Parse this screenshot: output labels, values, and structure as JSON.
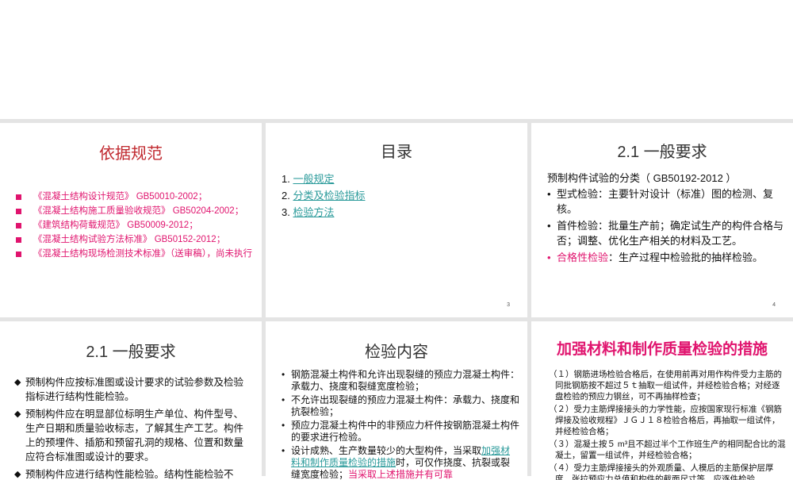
{
  "slides": [
    {
      "title": "依据规范",
      "items": [
        "《混凝土结构设计规范》 GB50010-2002；",
        "《混凝土结构施工质量验收规范》 GB50204-2002；",
        "《建筑结构荷载规范》 GB50009-2012；",
        "《混凝土结构试验方法标准》 GB50152-2012；",
        "《混凝土结构现场检测技术标准》（送审稿），尚未执行"
      ]
    },
    {
      "title": "目录",
      "items": [
        {
          "num": "1.",
          "label": "一般规定"
        },
        {
          "num": "2.",
          "label": "分类及检验指标"
        },
        {
          "num": "3.",
          "label": "检验方法"
        }
      ],
      "page": "3"
    },
    {
      "title": "2.1 一般要求",
      "lead": "预制构件试验的分类（ GB50192-2012 ）",
      "items": [
        "型式检验：主要针对设计（标准）图的检测、复核。",
        "首件检验：批量生产前；确定试生产的构件合格与否；调整、优化生产相关的材料及工艺。"
      ],
      "highlight_term": "合格性检验",
      "highlight_rest": "：生产过程中检验批的抽样检验。",
      "page": "4"
    },
    {
      "title": "2.1 一般要求",
      "items": [
        "预制构件应按标准图或设计要求的试验参数及检验指标进行结构性能检验。",
        "预制构件应在明显部位标明生产单位、构件型号、生产日期和质量验收标志，了解其生产工艺。构件上的预埋件、插筋和预留孔洞的规格、位置和数量应符合标准图或设计的要求。",
        "预制构件应进行结构性能检验。结构性能检验不"
      ]
    },
    {
      "title": "检验内容",
      "items": [
        "钢筋混凝土构件和允许出现裂缝的预应力混凝土构件：承载力、挠度和裂缝宽度检验；",
        "不允许出现裂缝的预应力混凝土构件：承载力、挠度和抗裂检验；",
        "预应力混凝土构件中的非预应力杆件按钢筋混凝土构件的要求进行检验。"
      ],
      "last_pre": "设计成熟、生产数量较少的大型构件，当采取",
      "last_link": "加强材料和制作质量检验的措施",
      "last_mid": "时，可仅作挠度、抗裂或裂缝宽度检验；",
      "last_pink": "当采取上述措施并有可靠"
    },
    {
      "title": "加强材料和制作质量检验的措施",
      "items": [
        "（１）钢筋进场检验合格后，在使用前再对用作构件受力主筋的同批钢筋按不超过５ｔ抽取一组试件，并经检验合格；对经逐盘检验的预应力钢丝，可不再抽样检查；",
        "（２）受力主筋焊接接头的力学性能，应按国家现行标准《钢筋焊接及验收规程》ＪＧＪ１８检验合格后，再抽取一组试件，并经检验合格；",
        "（３）混凝土按５ m³且不超过半个工作班生产的相同配合比的混凝土，留置一组试件，并经检验合格；",
        "（４）受力主筋焊接接头的外观质量、人模后的主筋保护层厚度、张拉预应力总值和构件的截面尺寸等，应逐件检验"
      ]
    }
  ]
}
